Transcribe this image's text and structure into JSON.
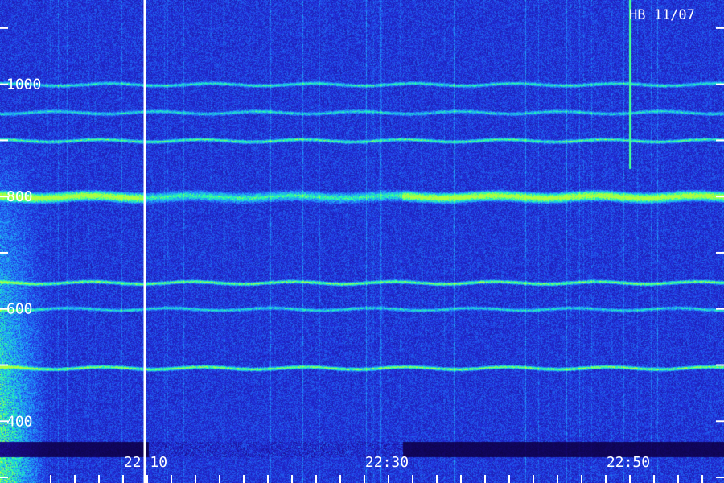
{
  "chart_data": {
    "type": "heatmap",
    "title": "",
    "annotation": "HB 11/07",
    "xlabel": "",
    "ylabel": "",
    "x_tick_labels": [
      {
        "label": "22:10",
        "minute": 10
      },
      {
        "label": "22:30",
        "minute": 30
      },
      {
        "label": "22:50",
        "minute": 50
      }
    ],
    "x_minor_minutes": [
      2,
      4,
      6,
      8,
      10,
      12,
      14,
      16,
      18,
      20,
      22,
      24,
      26,
      28,
      30,
      32,
      34,
      36,
      38,
      40,
      42,
      44,
      46,
      48,
      50,
      52,
      54,
      56,
      58
    ],
    "xlim_minutes": [
      -2.2,
      57.8
    ],
    "y_tick_labels": [
      {
        "label": "400",
        "value": 400
      },
      {
        "label": "600",
        "value": 600
      },
      {
        "label": "800",
        "value": 800
      },
      {
        "label": "1000",
        "value": 1000
      }
    ],
    "y_minor_values": [
      300,
      400,
      500,
      600,
      700,
      800,
      900,
      1000,
      1100
    ],
    "ylim": [
      290,
      1150
    ],
    "colormap": [
      "#07012a",
      "#1a0a8c",
      "#2233e0",
      "#20a0ff",
      "#20ffb0",
      "#b0ff40"
    ],
    "marker_line_minute": 9.8,
    "marker_color": "#ffffff",
    "emission_lines": [
      {
        "value": 495,
        "strength": 0.75
      },
      {
        "value": 647,
        "strength": 0.7
      },
      {
        "value": 600,
        "strength": 0.45
      },
      {
        "value": 800,
        "strength": 1.0
      },
      {
        "value": 900,
        "strength": 0.6
      },
      {
        "value": 950,
        "strength": 0.45
      },
      {
        "value": 1000,
        "strength": 0.5
      }
    ]
  }
}
